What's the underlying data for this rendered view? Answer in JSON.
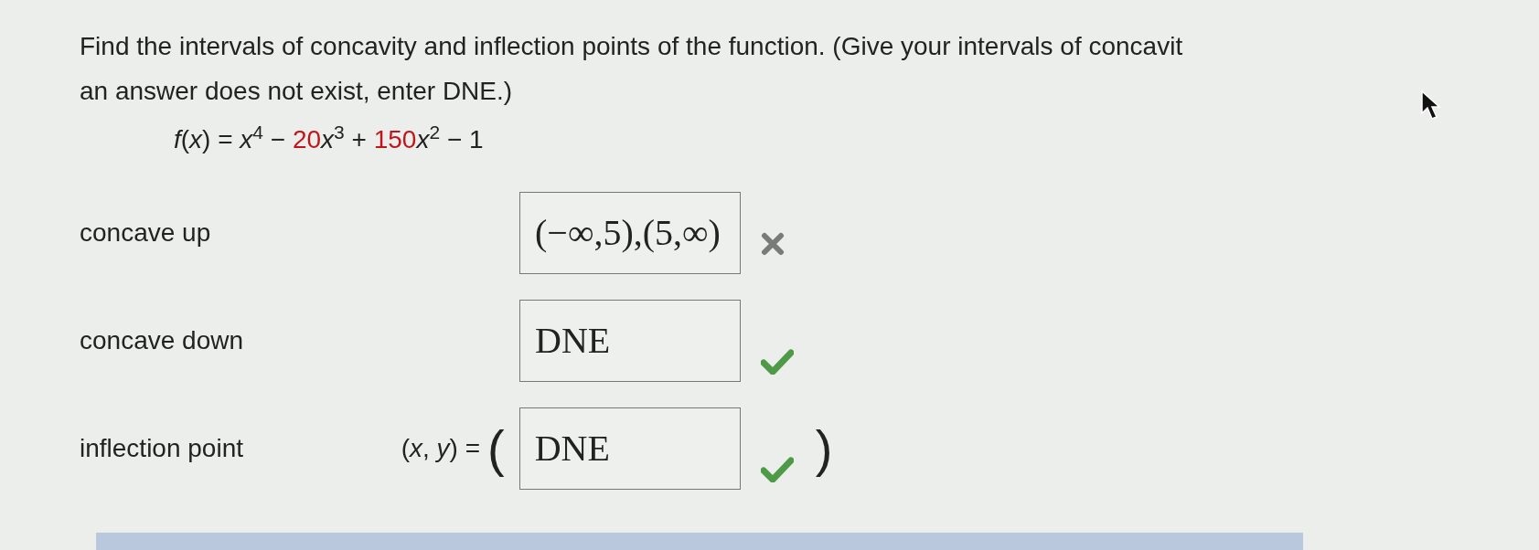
{
  "question": {
    "lines": [
      "Find the intervals of concavity and inflection points of the function. (Give your intervals of concavit",
      "an answer does not exist, enter DNE.)"
    ],
    "formula": [
      {
        "text": "*f*(*x*) = *x*$^{4}$ − ",
        "highlight": false
      },
      {
        "text": "20",
        "highlight": true
      },
      {
        "text": "*x*$^{3}$ + ",
        "highlight": false
      },
      {
        "text": "150",
        "highlight": true
      },
      {
        "text": "*x*$^{2}$ − 1",
        "highlight": false
      }
    ]
  },
  "answers": [
    {
      "label": "concave up",
      "value": "(−∞,5),(5,∞)",
      "correct": false
    },
    {
      "label": "concave down",
      "value": "DNE",
      "correct": true
    },
    {
      "label": "inflection point",
      "prefix": "(*x*, *y*) =",
      "open": "(",
      "value": "DNE",
      "close": ")",
      "correct": true
    }
  ],
  "panel": {
    "kind": "additional-materials"
  }
}
